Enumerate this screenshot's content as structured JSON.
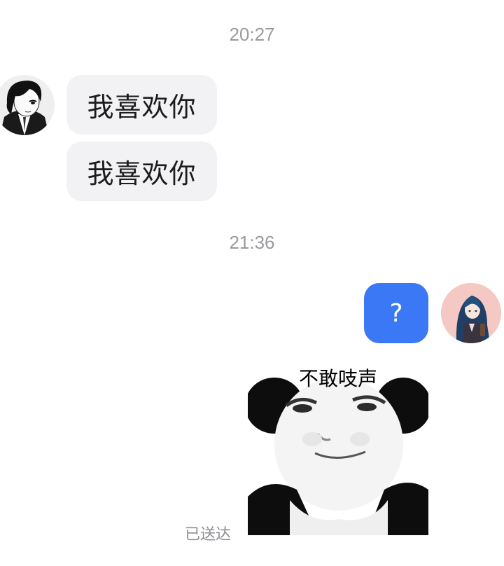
{
  "timestamps": [
    "20:27",
    "21:36"
  ],
  "incoming": {
    "avatar_icon": "manga-character-avatar-icon",
    "messages": [
      "我喜欢你",
      "我喜欢你"
    ]
  },
  "outgoing": {
    "avatar_icon": "anime-girl-avatar-icon",
    "bubble_color": "#3b78f5",
    "text_message": "?",
    "sticker": {
      "icon": "panda-meme-sticker-icon",
      "caption": "不敢吱声"
    },
    "status": "已送达"
  }
}
